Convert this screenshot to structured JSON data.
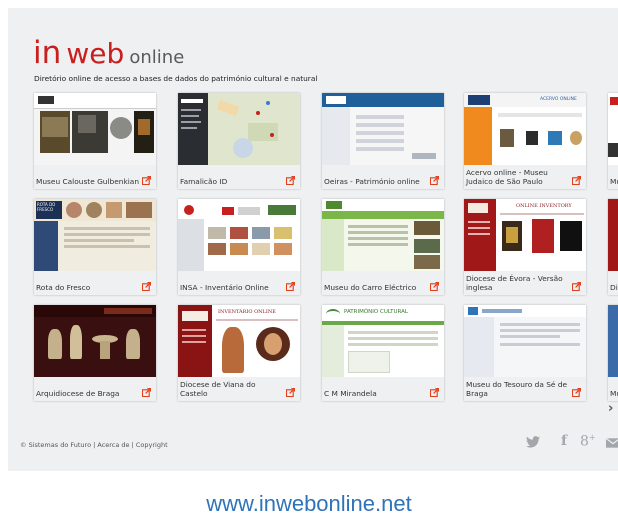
{
  "header": {
    "logo_in": "in",
    "logo_web": "web",
    "logo_online": "online",
    "subtitle": "Diretório online de acesso a bases de dados do património cultural e natural"
  },
  "cards": [
    {
      "label": "Museu Calouste Gulbenkian"
    },
    {
      "label": "Famalicão ID"
    },
    {
      "label": "Oeiras - Património online"
    },
    {
      "label": "Acervo online - Museu Judaico de São Paulo"
    },
    {
      "label": "Mu"
    },
    {
      "label": "Rota do Fresco"
    },
    {
      "label": "INSA - Inventário Online"
    },
    {
      "label": "Museu do Carro Eléctrico"
    },
    {
      "label": "Diocese de Évora - Versão inglesa"
    },
    {
      "label": "Di"
    },
    {
      "label": "Arquidiocese de Braga"
    },
    {
      "label": "Diocese de Viana do Castelo"
    },
    {
      "label": "C M Mirandela"
    },
    {
      "label": "Museu do Tesouro da Sé de Braga"
    },
    {
      "label": "Mu"
    }
  ],
  "thumbnail_text": {
    "acervo": "ACERVO ONLINE",
    "online_inventory": "ONLINE INVENTORY",
    "inventario_online": "INVENTÁRIO ONLINE",
    "patrimonio": "PATRIMÓNIO CULTURAL",
    "rota": "ROTA DO FRESCO"
  },
  "footer": {
    "text": "© Sistemas do Futuro | Acerca de | Copyright"
  },
  "social": {
    "twitter": "twitter-icon",
    "facebook": "facebook-icon",
    "googleplus": "google-plus-icon",
    "email": "email-icon"
  },
  "nav": {
    "next": "›"
  },
  "watermark": {
    "url": "www.inwebonline.net"
  },
  "colors": {
    "brand_red": "#c8201e",
    "panel_bg": "#eef0f2",
    "link_blue": "#2f73b8",
    "icon_gray": "#a3a6ab"
  }
}
